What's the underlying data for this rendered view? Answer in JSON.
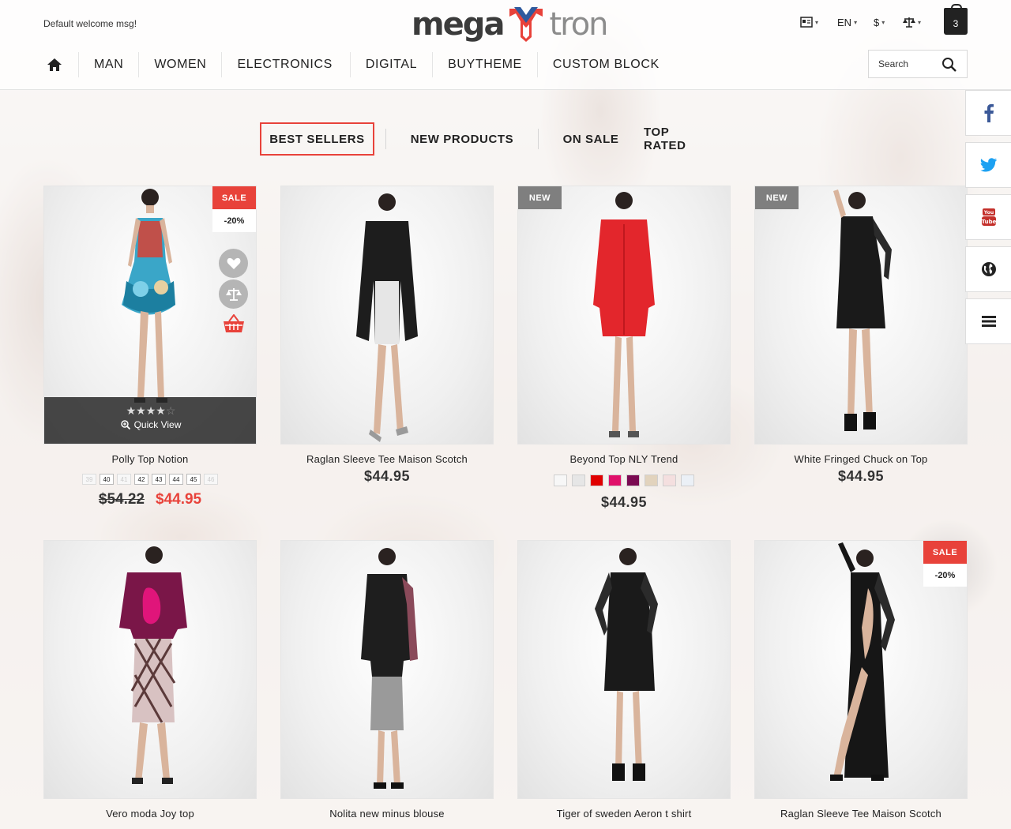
{
  "header": {
    "welcome": "Default welcome msg!",
    "logo_left": "mega",
    "logo_right": "tron",
    "lang": "EN",
    "currency": "$",
    "cart_count": "3",
    "search_placeholder": "Search"
  },
  "nav": {
    "items": [
      "MAN",
      "WOMEN",
      "ELECTRONICS",
      "DIGITAL",
      "BUYTHEME",
      "CUSTOM BLOCK"
    ]
  },
  "tabs": [
    "BEST SELLERS",
    "NEW PRODUCTS",
    "ON SALE",
    "TOP RATED"
  ],
  "colors": {
    "accent": "#e8423a",
    "new_badge": "#7f7f7f",
    "dark": "#222222"
  },
  "products": [
    {
      "name": "Polly Top Notion",
      "badge": "SALE",
      "discount": "-20%",
      "rating": 4,
      "quick_view": "Quick View",
      "sizes": [
        {
          "label": "39",
          "available": false
        },
        {
          "label": "40",
          "available": true
        },
        {
          "label": "41",
          "available": false
        },
        {
          "label": "42",
          "available": true
        },
        {
          "label": "43",
          "available": true
        },
        {
          "label": "44",
          "available": true
        },
        {
          "label": "45",
          "available": true
        },
        {
          "label": "46",
          "available": false
        }
      ],
      "old_price": "$54.22",
      "price": "$44.95"
    },
    {
      "name": "Raglan Sleeve Tee Maison Scotch",
      "price": "$44.95"
    },
    {
      "name": "Beyond Top NLY Trend",
      "badge": "NEW",
      "swatches": [
        "#f7f7f7",
        "#e6e6e6",
        "#e00000",
        "#e0106a",
        "#7a0a52",
        "#e2d3bd",
        "#f4dfdf",
        "#ebf0f6"
      ],
      "price": "$44.95"
    },
    {
      "name": "White Fringed Chuck on Top",
      "badge": "NEW",
      "price": "$44.95"
    },
    {
      "name": "Vero moda Joy top"
    },
    {
      "name": "Nolita new minus blouse"
    },
    {
      "name": "Tiger of sweden Aeron t shirt"
    },
    {
      "name": "Raglan Sleeve Tee Maison Scotch",
      "badge": "SALE",
      "discount": "-20%"
    }
  ]
}
